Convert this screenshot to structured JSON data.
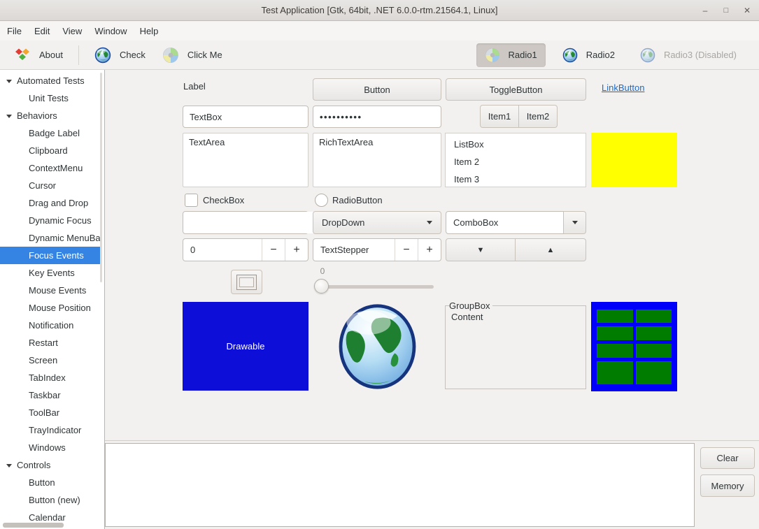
{
  "window": {
    "title": "Test Application [Gtk, 64bit, .NET 6.0.0-rtm.21564.1, Linux]",
    "minimize_glyph": "–",
    "maximize_glyph": "□",
    "close_glyph": "✕"
  },
  "menubar": {
    "items": [
      "File",
      "Edit",
      "View",
      "Window",
      "Help"
    ]
  },
  "toolbar": {
    "buttons": [
      {
        "label": "About",
        "icon": "eto-logo-icon"
      },
      {
        "label": "Check",
        "icon": "globe-icon"
      },
      {
        "label": "Click Me",
        "icon": "color-wheel-icon"
      }
    ],
    "radios": [
      {
        "label": "Radio1",
        "icon": "color-wheel-icon",
        "selected": true,
        "disabled": false
      },
      {
        "label": "Radio2",
        "icon": "globe-icon",
        "selected": false,
        "disabled": false
      },
      {
        "label": "Radio3 (Disabled)",
        "icon": "globe-icon",
        "selected": false,
        "disabled": true
      }
    ]
  },
  "sidebar": {
    "items": [
      {
        "label": "Automated Tests",
        "level": 0,
        "expanded": true
      },
      {
        "label": "Unit Tests",
        "level": 1
      },
      {
        "label": "Behaviors",
        "level": 0,
        "expanded": true
      },
      {
        "label": "Badge Label",
        "level": 1
      },
      {
        "label": "Clipboard",
        "level": 1
      },
      {
        "label": "ContextMenu",
        "level": 1
      },
      {
        "label": "Cursor",
        "level": 1
      },
      {
        "label": "Drag and Drop",
        "level": 1
      },
      {
        "label": "Dynamic Focus",
        "level": 1
      },
      {
        "label": "Dynamic MenuBa",
        "level": 1
      },
      {
        "label": "Focus Events",
        "level": 1,
        "selected": true
      },
      {
        "label": "Key Events",
        "level": 1
      },
      {
        "label": "Mouse Events",
        "level": 1
      },
      {
        "label": "Mouse Position",
        "level": 1
      },
      {
        "label": "Notification",
        "level": 1
      },
      {
        "label": "Restart",
        "level": 1
      },
      {
        "label": "Screen",
        "level": 1
      },
      {
        "label": "TabIndex",
        "level": 1
      },
      {
        "label": "Taskbar",
        "level": 1
      },
      {
        "label": "ToolBar",
        "level": 1
      },
      {
        "label": "TrayIndicator",
        "level": 1
      },
      {
        "label": "Windows",
        "level": 1
      },
      {
        "label": "Controls",
        "level": 0,
        "expanded": true
      },
      {
        "label": "Button",
        "level": 1
      },
      {
        "label": "Button (new)",
        "level": 1
      },
      {
        "label": "Calendar",
        "level": 1
      }
    ]
  },
  "content": {
    "label_text": "Label",
    "button_label": "Button",
    "toggle_button_label": "ToggleButton",
    "link_button_label": "LinkButton",
    "textbox_value": "TextBox",
    "password_value": "••••••••••",
    "segmented_buttons": [
      "Item1",
      "Item2"
    ],
    "textarea_value": "TextArea",
    "rich_textarea_value": "RichTextArea",
    "listbox_items": [
      "ListBox",
      "Item 2",
      "Item 3"
    ],
    "checkbox_label": "CheckBox",
    "checkbox_checked": false,
    "radio_label": "RadioButton",
    "radio_selected": false,
    "editable_combo_value": "",
    "dropdown_value": "DropDown",
    "combobox_value": "ComboBox",
    "numeric_stepper_value": "0",
    "text_stepper_value": "TextStepper",
    "stepper_minus_glyph": "−",
    "stepper_plus_glyph": "+",
    "down_button_glyph": "▼",
    "up_button_glyph": "▲",
    "slider_value": "0",
    "drawable_label": "Drawable",
    "groupbox_title": "GroupBox",
    "groupbox_content": "Content",
    "grid_box": {
      "rows": 4,
      "cols": 2
    }
  },
  "bottom_panel": {
    "clear_label": "Clear",
    "memory_label": "Memory"
  },
  "colors": {
    "selection_blue": "#3584e4",
    "drawable_blue": "#0e0ed9",
    "grid_blue": "#0000fa",
    "grid_green": "#007d00",
    "yellow_box": "#ffff00",
    "link_blue": "#1b6acb"
  }
}
